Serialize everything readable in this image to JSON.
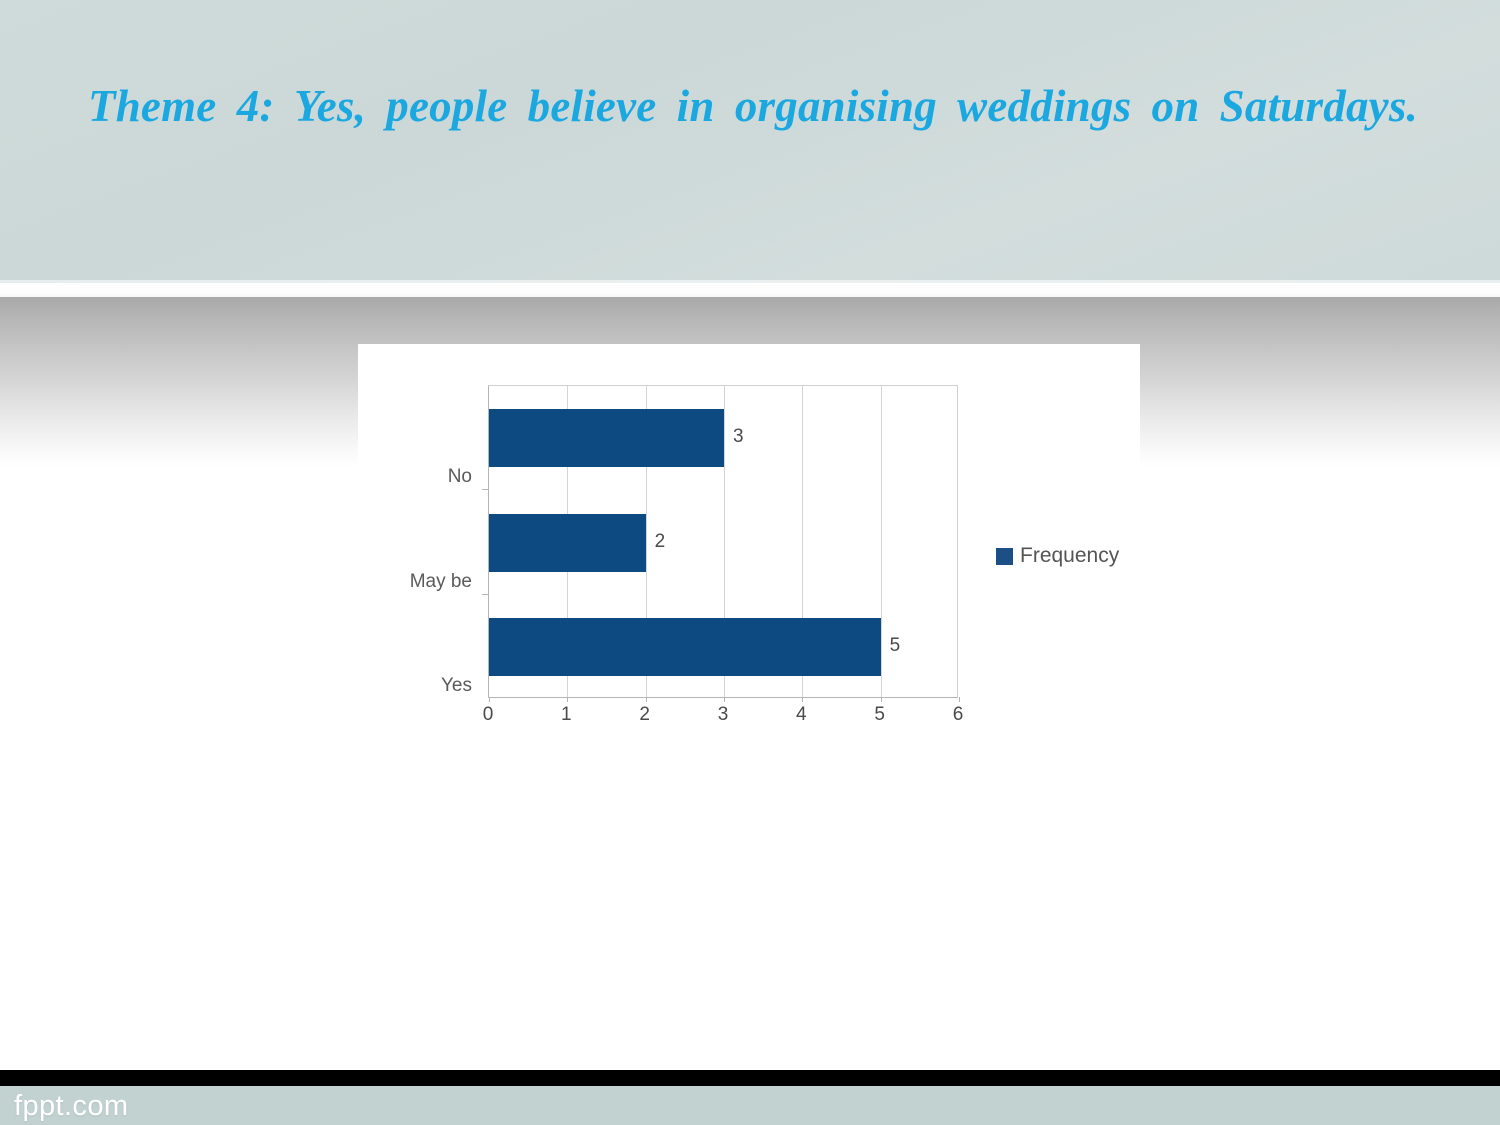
{
  "slide": {
    "title": "Theme 4: Yes, people believe in organising weddings on Saturdays.",
    "title_color": "#1ba8e0",
    "header_bg": "#cfdbda",
    "footer_bg": "#c2d2d0",
    "watermark": "fppt.com"
  },
  "chart_data": {
    "type": "bar",
    "orientation": "horizontal",
    "title": "",
    "subtitle": "",
    "xlabel": "",
    "ylabel": "",
    "categories": [
      "Yes",
      "May be",
      "No"
    ],
    "categories_top_to_bottom": [
      "No",
      "May be",
      "Yes"
    ],
    "series": [
      {
        "name": "Frequency",
        "values": [
          5,
          2,
          3
        ],
        "color": "#0e4a82"
      }
    ],
    "values": [
      5,
      2,
      3
    ],
    "data_labels": [
      "5",
      "2",
      "3"
    ],
    "xlim": [
      0,
      6
    ],
    "xticks": [
      0,
      1,
      2,
      3,
      4,
      5,
      6
    ],
    "xtick_labels": [
      "0",
      "1",
      "2",
      "3",
      "4",
      "5",
      "6"
    ],
    "grid": true,
    "grid_axis": "x",
    "legend": {
      "position": "right",
      "entries": [
        "Frequency"
      ]
    },
    "bar_color": "#0e4a82",
    "plot_bg": "#ffffff"
  }
}
